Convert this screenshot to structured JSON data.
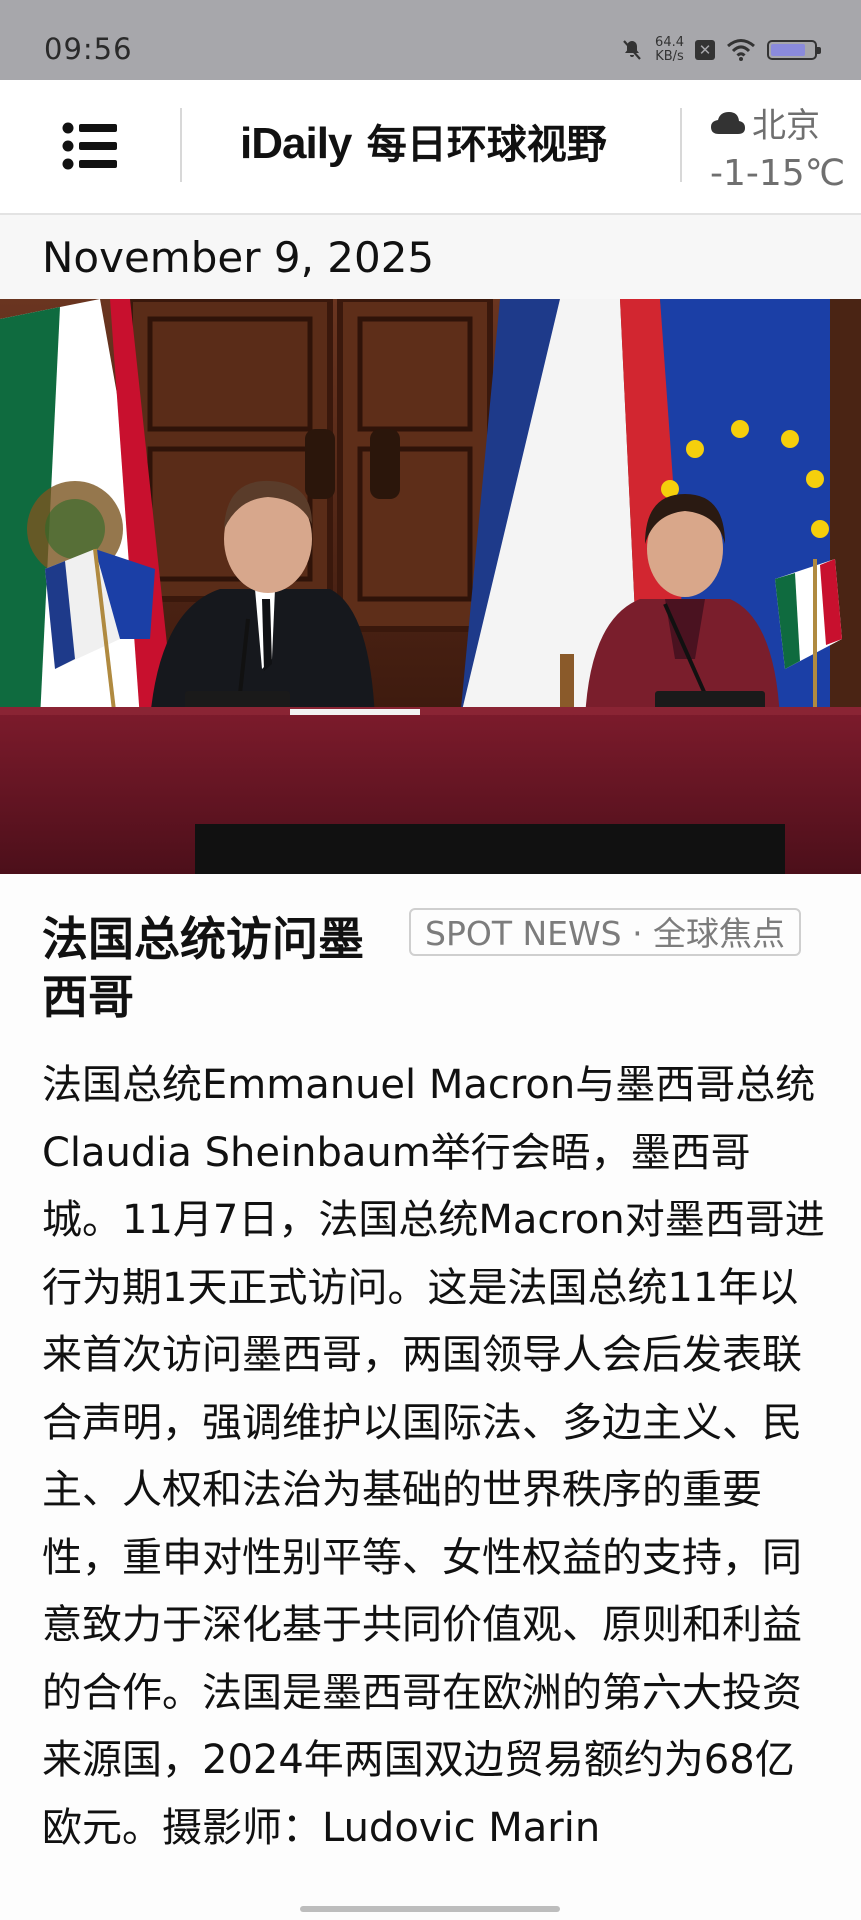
{
  "status_bar": {
    "time": "09:56",
    "net_speed_value": "64.4",
    "net_speed_unit": "KB/s",
    "icons": [
      "mute-icon",
      "sim-off-icon",
      "wifi-icon",
      "battery-icon"
    ]
  },
  "header": {
    "brand_latin": "iDaily",
    "brand_cn": "每日环球视野",
    "weather_city": "北京",
    "weather_temp": "-1-15℃",
    "weather_icon": "cloud-icon"
  },
  "date": "November 9, 2025",
  "article": {
    "title": "法国总统访问墨西哥",
    "tag": "SPOT NEWS · 全球焦点",
    "body": "法国总统Emmanuel Macron与墨西哥总统Claudia Sheinbaum举行会晤，墨西哥城。11月7日，法国总统Macron对墨西哥进行为期1天正式访问。这是法国总统11年以来首次访问墨西哥，两国领导人会后发表联合声明，强调维护以国际法、多边主义、民主、人权和法治为基础的世界秩序的重要性，重申对性别平等、女性权益的支持，同意致力于深化基于共同价值观、原则和利益的合作。法国是墨西哥在欧洲的第六大投资来源国，2024年两国双边贸易额约为68亿欧元。摄影师：Ludovic Marin"
  },
  "colors": {
    "status_bar_bg": "#a7a7ab",
    "tablecloth": "#6e1626",
    "wood": "#5a2c18"
  }
}
